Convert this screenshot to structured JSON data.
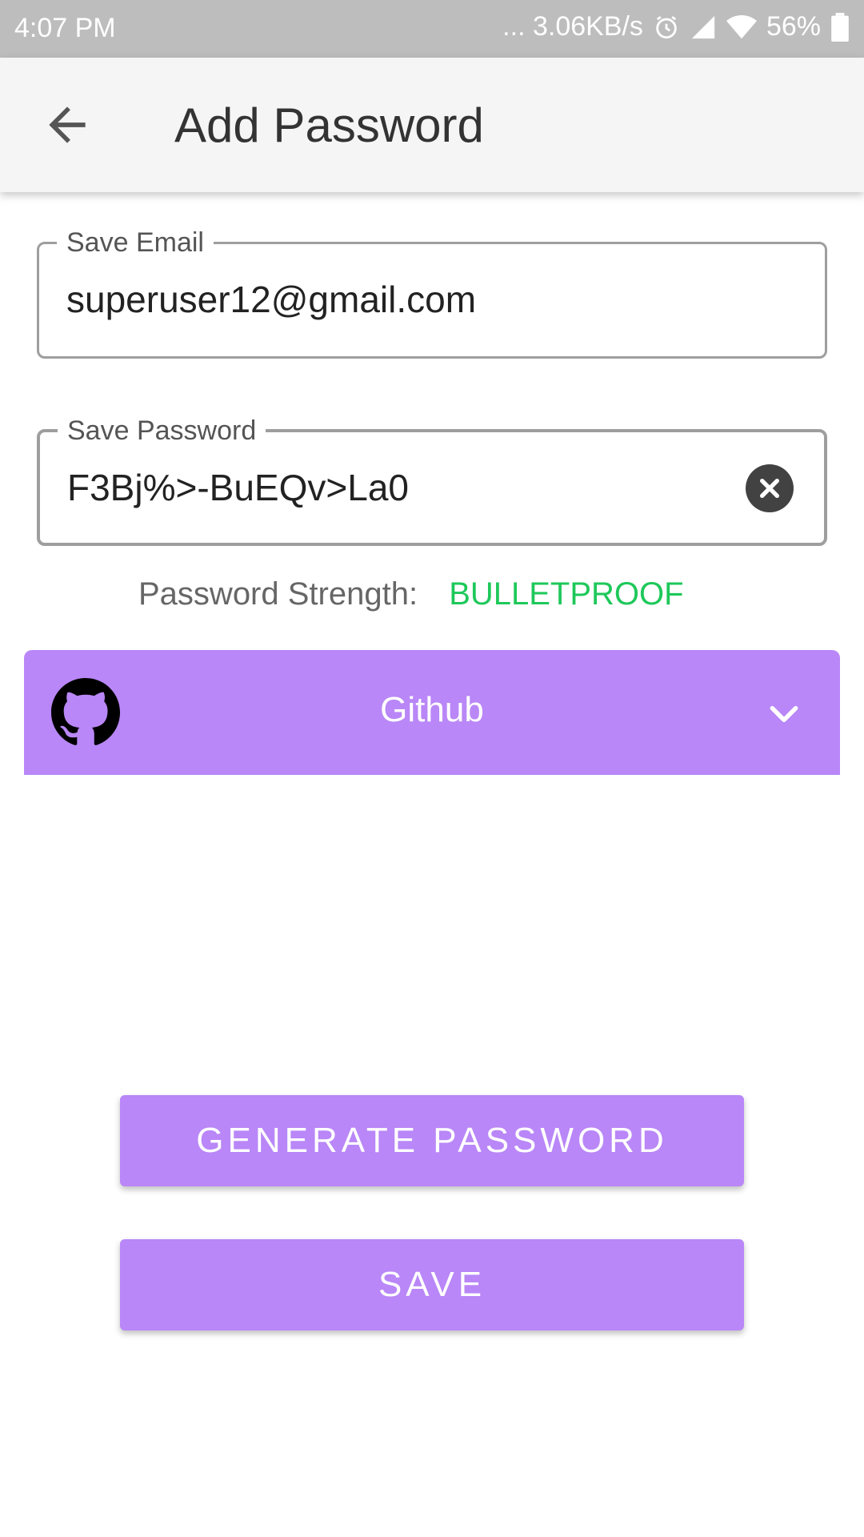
{
  "status_bar": {
    "time": "4:07 PM",
    "network_speed": "... 3.06KB/s",
    "battery": "56%"
  },
  "app_bar": {
    "title": "Add Password",
    "back_icon": "arrow-left-icon"
  },
  "email_field": {
    "label": "Save Email",
    "value": "superuser12@gmail.com"
  },
  "password_field": {
    "label": "Save Password",
    "value": "F3Bj%>-BuEQv>La0",
    "clear_icon": "close-circle-icon"
  },
  "strength": {
    "label": "Password Strength:",
    "value": "BULLETPROOF",
    "color": "#1ec85a"
  },
  "site_select": {
    "selected": "Github",
    "icon": "github-icon",
    "chevron_icon": "chevron-down-icon",
    "color": "#b987f7"
  },
  "actions": {
    "generate_label": "GENERATE PASSWORD",
    "save_label": "SAVE"
  }
}
